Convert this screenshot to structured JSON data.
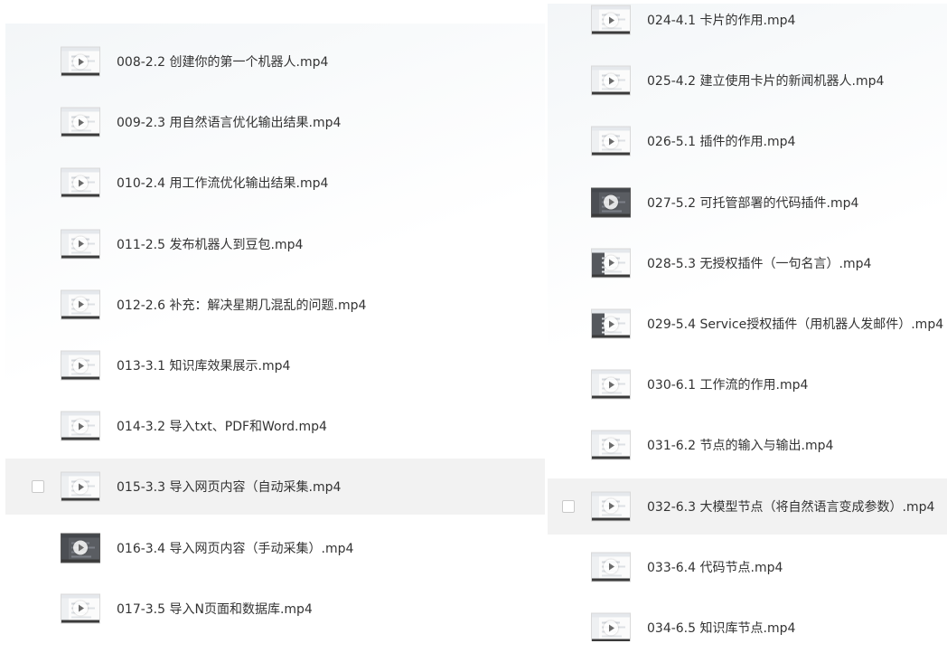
{
  "left_panel": {
    "files": [
      {
        "name": "008-2.2 创建你的第一个机器人.mp4",
        "selected": false,
        "thumb": "light"
      },
      {
        "name": "009-2.3 用自然语言优化输出结果.mp4",
        "selected": false,
        "thumb": "light"
      },
      {
        "name": "010-2.4 用工作流优化输出结果.mp4",
        "selected": false,
        "thumb": "light"
      },
      {
        "name": "011-2.5 发布机器人到豆包.mp4",
        "selected": false,
        "thumb": "light"
      },
      {
        "name": "012-2.6 补充：解决星期几混乱的问题.mp4",
        "selected": false,
        "thumb": "light"
      },
      {
        "name": "013-3.1 知识库效果展示.mp4",
        "selected": false,
        "thumb": "light"
      },
      {
        "name": "014-3.2 导入txt、PDF和Word.mp4",
        "selected": false,
        "thumb": "light"
      },
      {
        "name": "015-3.3 导入网页内容（自动采集.mp4",
        "selected": true,
        "thumb": "light"
      },
      {
        "name": "016-3.4 导入网页内容（手动采集）.mp4",
        "selected": false,
        "thumb": "dark"
      },
      {
        "name": "017-3.5 导入N页面和数据库.mp4",
        "selected": false,
        "thumb": "light"
      }
    ]
  },
  "right_panel": {
    "files": [
      {
        "name": "024-4.1 卡片的作用.mp4",
        "selected": false,
        "thumb": "light"
      },
      {
        "name": "025-4.2 建立使用卡片的新闻机器人.mp4",
        "selected": false,
        "thumb": "light"
      },
      {
        "name": "026-5.1 插件的作用.mp4",
        "selected": false,
        "thumb": "light"
      },
      {
        "name": "027-5.2 可托管部署的代码插件.mp4",
        "selected": false,
        "thumb": "dark"
      },
      {
        "name": "028-5.3 无授权插件（一句名言）.mp4",
        "selected": false,
        "thumb": "dark-side"
      },
      {
        "name": "029-5.4 Service授权插件（用机器人发邮件）.mp4",
        "selected": false,
        "thumb": "dark-side"
      },
      {
        "name": "030-6.1 工作流的作用.mp4",
        "selected": false,
        "thumb": "light"
      },
      {
        "name": "031-6.2 节点的输入与输出.mp4",
        "selected": false,
        "thumb": "light"
      },
      {
        "name": "032-6.3 大模型节点（将自然语言变成参数）.mp4",
        "selected": true,
        "thumb": "light"
      },
      {
        "name": "033-6.4 代码节点.mp4",
        "selected": false,
        "thumb": "light"
      },
      {
        "name": "034-6.5 知识库节点.mp4",
        "selected": false,
        "thumb": "light"
      }
    ]
  },
  "icons": {
    "thumbnail": "video-thumbnail-icon",
    "play": "play-icon",
    "checkbox": "checkbox-icon"
  },
  "colors": {
    "selected_row": "#f2f2f2",
    "text": "#333333"
  }
}
